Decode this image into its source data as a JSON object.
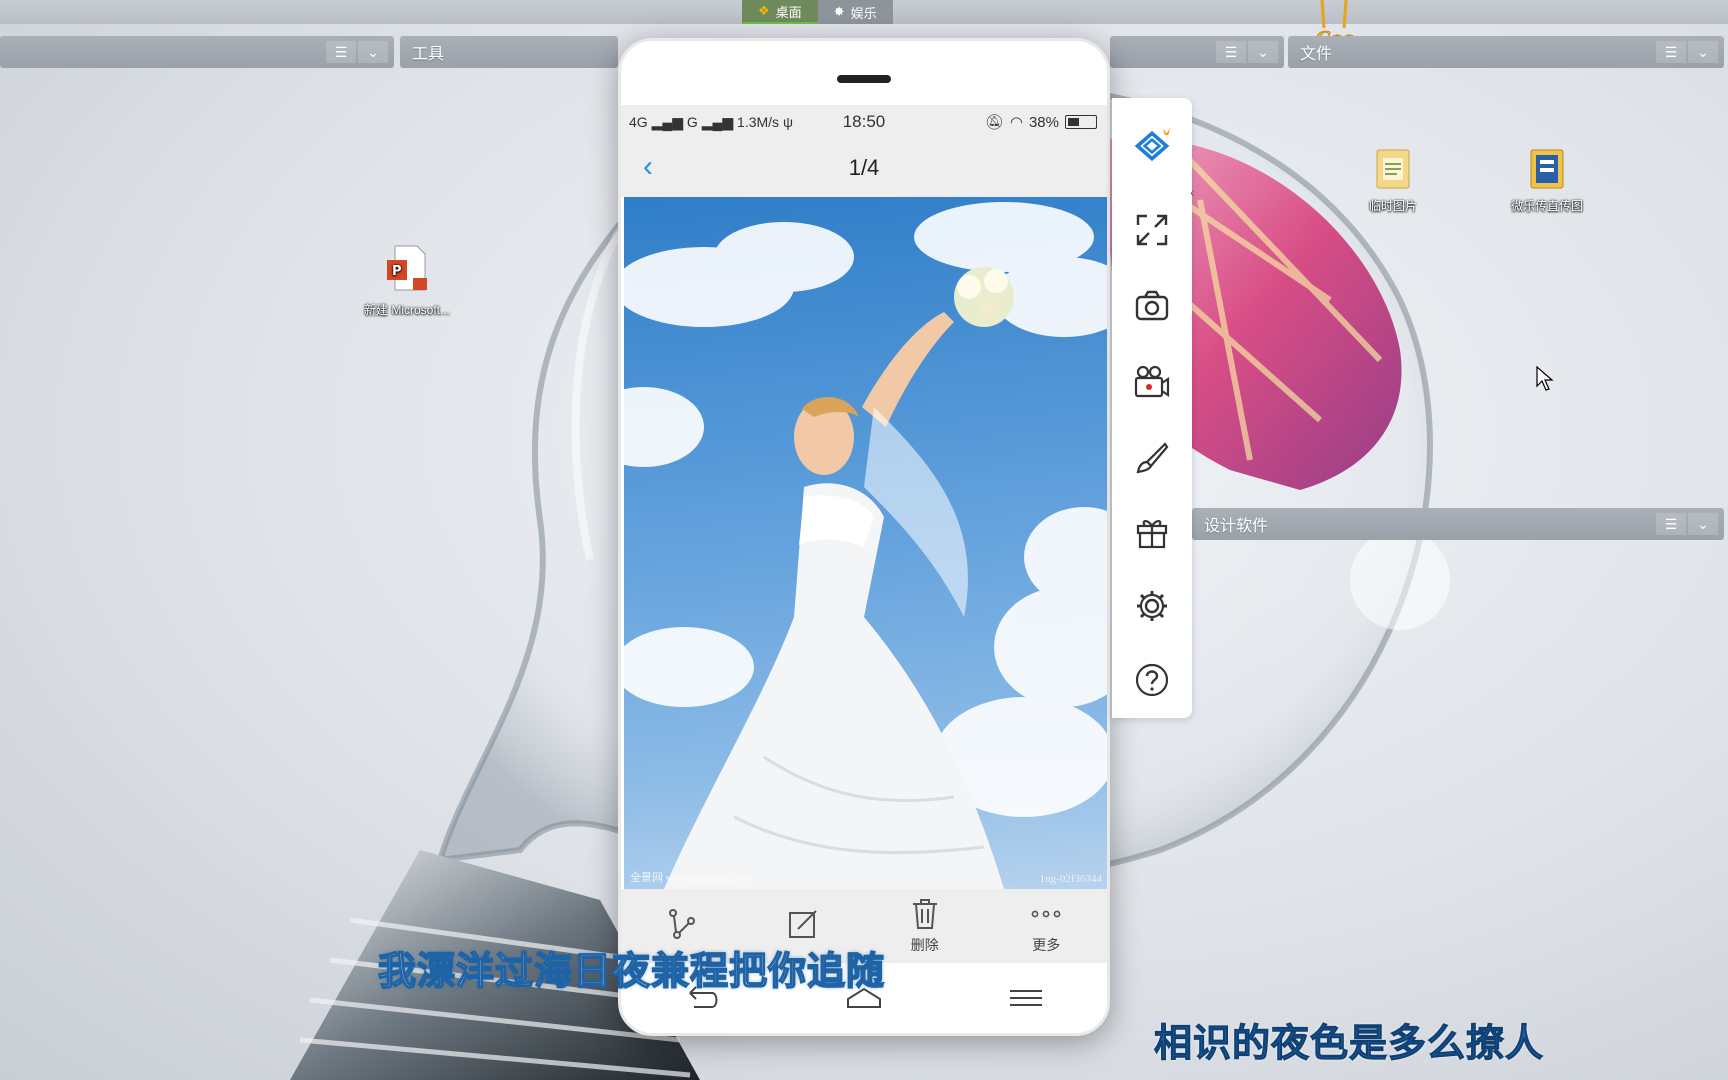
{
  "taskbar": {
    "tabs": [
      {
        "label": "桌面",
        "icon": "windows-logo-icon",
        "active": true
      },
      {
        "label": "娱乐",
        "icon": "star-icon",
        "active": false
      }
    ]
  },
  "fences": {
    "left_title": "",
    "tools_title": "工具",
    "middle_title": "",
    "files_title": "文件",
    "design_title": "设计软件"
  },
  "desktop_icons": [
    {
      "label": "新建 Microsoft...",
      "icon": "powerpoint-file-icon"
    },
    {
      "label": "临时图片",
      "icon": "folder-icon"
    },
    {
      "label": "微乐传直传图",
      "icon": "document-folder-icon"
    }
  ],
  "phone": {
    "status": {
      "network": "4G",
      "network2": "G",
      "speed": "1.3M/s",
      "time": "18:50",
      "battery": "38%"
    },
    "header": {
      "counter": "1/4"
    },
    "photo": {
      "watermark": "全景网 www.quanjing.com",
      "image_id": "1ng-02f36344"
    },
    "actions": [
      {
        "label": "",
        "icon": "share-icon"
      },
      {
        "label": "",
        "icon": "edit-icon"
      },
      {
        "label": "删除",
        "icon": "trash-icon"
      },
      {
        "label": "更多",
        "icon": "more-dots-icon"
      }
    ]
  },
  "side_toolbar": {
    "tools": [
      "fullscreen-icon",
      "screenshot-camera-icon",
      "video-record-icon",
      "brush-icon",
      "gift-icon",
      "settings-icon",
      "help-icon"
    ]
  },
  "subtitles": {
    "line1": "我漂洋过海日夜兼程把你追随",
    "line2": "相识的夜色是多么撩人"
  },
  "colors": {
    "accent_blue": "#2b8be5",
    "subtitle_blue": "#1e63a6",
    "fence_gray": "#9aa1a9",
    "active_tab_green": "#69c24a"
  }
}
